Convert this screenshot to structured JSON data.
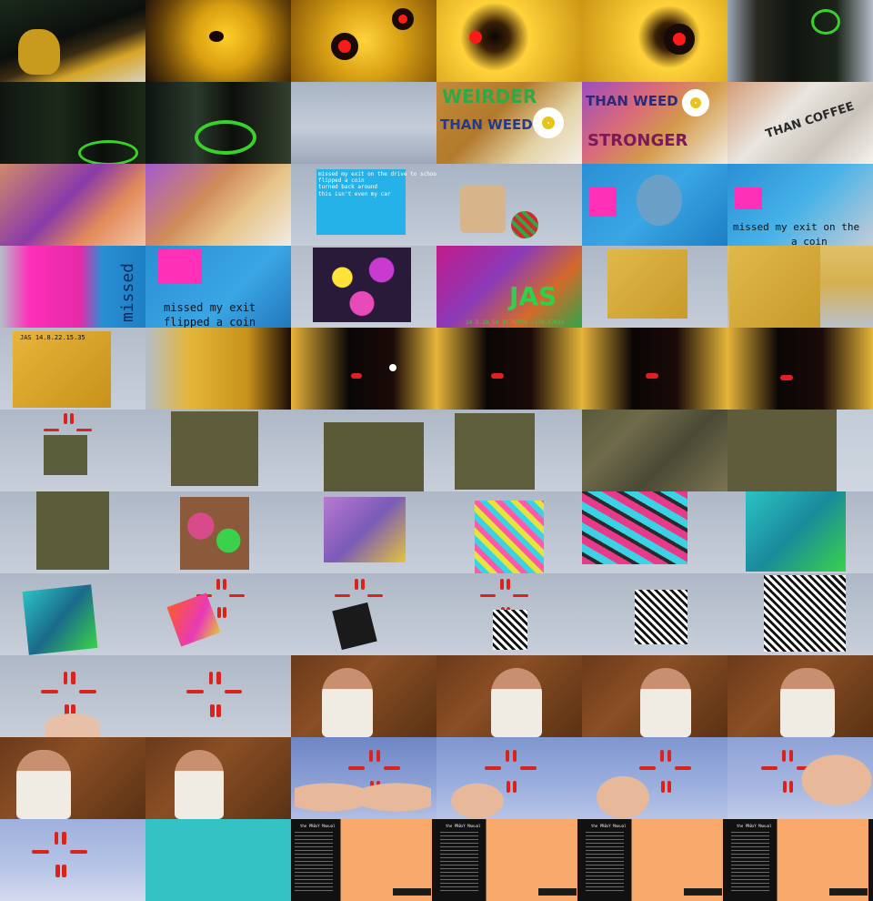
{
  "contact_sheet": {
    "columns": 6,
    "rows": 11,
    "frames": [
      {
        "name": "frame-r1c1",
        "bg": "linear-gradient(160deg,#1a2a1c 0%,#0c0f0c 45%,#3b2c12 60%,#d6a526 75%,#d8d0bc 100%)"
      },
      {
        "name": "frame-r1c2",
        "bg": "radial-gradient(circle at 55% 45%,#ffcf2a 0%,#d89e10 35%,#6b4608 70%,#1b0c0a 100%)"
      },
      {
        "name": "frame-r1c3",
        "bg": "radial-gradient(circle at 50% 50%,#ffd43a 0%,#d8a014 45%,#8a5a08 100%)"
      },
      {
        "name": "frame-r1c4",
        "bg": "radial-gradient(circle at 40% 45%,#0e0604 0%,#3a2006 15%,#ffd23a 35%,#c99312 100%)"
      },
      {
        "name": "frame-r1c5",
        "bg": "radial-gradient(circle at 60% 45%,#0e0604 0%,#3a2006 14%,#ffd23a 32%,#c99312 100%)"
      },
      {
        "name": "frame-r1c6",
        "bg": "linear-gradient(90deg,#9aa6b6 0%,#2a2a22 20%,#0f1410 45%,#1b241a 75%,#b6bcc8 100%)"
      },
      {
        "name": "frame-r2c1",
        "bg": "linear-gradient(90deg,#121612 0%,#1b2a1a 40%,#0c100c 70%,#1d2a18 100%)"
      },
      {
        "name": "frame-r2c2",
        "bg": "linear-gradient(90deg,#0e1410 0%,#2b3a2c 35%,#0c0f0c 60%,#34402e 100%)"
      },
      {
        "name": "frame-r2c3",
        "bg": "linear-gradient(180deg,#a8b4c4 0%,#c4ccd8 55%,#9da9bb 100%)"
      },
      {
        "name": "frame-r2c4",
        "bg": "linear-gradient(135deg,#c48a3a 0%,#b27a2c 40%,#e3d2a6 70%,#f4f0e8 100%)"
      },
      {
        "name": "frame-r2c5",
        "bg": "linear-gradient(135deg,#9b4fbf 0%,#d96a7a 35%,#d49a4a 60%,#f1ece2 100%)"
      },
      {
        "name": "frame-r2c6",
        "bg": "linear-gradient(135deg,#d59c78 0%,#e9e6e0 40%,#c9c3ba 70%,#f5f2ec 100%)"
      },
      {
        "name": "frame-r3c1",
        "bg": "linear-gradient(135deg,#d08a6a 0%,#8a3aa8 45%,#e28a5a 70%,#f3c4a4 100%)"
      },
      {
        "name": "frame-r3c2",
        "bg": "linear-gradient(135deg,#a35ad0 0%,#d08a5a 40%,#e7c48a 65%,#f0ece4 100%)"
      },
      {
        "name": "frame-r3c3",
        "bg": "linear-gradient(180deg,#a8b4c4 0%,#c4ccd8 100%)"
      },
      {
        "name": "frame-r3c4",
        "bg": "linear-gradient(180deg,#a8b4c4 0%,#c4ccd8 100%)"
      },
      {
        "name": "frame-r3c5",
        "bg": "linear-gradient(135deg,#2a8fd4 0%,#3aa6e4 50%,#1d7ec4 100%)"
      },
      {
        "name": "frame-r3c6",
        "bg": "linear-gradient(135deg,#2a8fd4 0%,#46b2e8 50%,#c4ccd8 100%)"
      },
      {
        "name": "frame-r4c1",
        "bg": "linear-gradient(90deg,#b4bdca 0%,#ff2fb8 20%,#e52aa8 55%,#2a8fd4 70%,#1d7ec4 100%)"
      },
      {
        "name": "frame-r4c2",
        "bg": "linear-gradient(135deg,#2a8fd4 0%,#3aa6e4 60%,#2277bd 100%)"
      },
      {
        "name": "frame-r4c3",
        "bg": "linear-gradient(180deg,#b4bdca 0%,#c8cfda 100%)"
      },
      {
        "name": "frame-r4c4",
        "bg": "linear-gradient(135deg,#c31a8a 0%,#8a3ab8 40%,#d46a2a 70%,#2fa44a 100%)"
      },
      {
        "name": "frame-r4c5",
        "bg": "linear-gradient(180deg,#aeb8c6 0%,#c5ccd8 100%)"
      },
      {
        "name": "frame-r4c6",
        "bg": "linear-gradient(180deg,#e0c06a 0%,#d6b050 45%,#b9c1cc 100%)"
      },
      {
        "name": "frame-r5c1",
        "bg": "linear-gradient(180deg,#b4bdca 0%,#c8cfda 100%)"
      },
      {
        "name": "frame-r5c2",
        "bg": "linear-gradient(90deg,#b4bdca 0%,#e4b63a 30%,#c8921a 70%,#1a0c08 100%)"
      },
      {
        "name": "frame-r5c3",
        "bg": "linear-gradient(90deg,#e8b43a 0%,#0a0606 40%,#1a0a08 70%,#e4b63a 100%)"
      },
      {
        "name": "frame-r5c4",
        "bg": "linear-gradient(90deg,#e8b43a 0%,#0a0606 35%,#1a0a08 65%,#e4b63a 100%)"
      },
      {
        "name": "frame-r5c5",
        "bg": "linear-gradient(90deg,#e8b43a 0%,#0a0606 35%,#1a0a08 65%,#e4b63a 100%)"
      },
      {
        "name": "frame-r5c6",
        "bg": "linear-gradient(90deg,#e8b43a 0%,#0a0606 35%,#1a0a08 65%,#e4b63a 100%)"
      },
      {
        "name": "frame-r6c1",
        "bg": "linear-gradient(180deg,#aeb8c6 0%,#c8cfda 100%)"
      },
      {
        "name": "frame-r6c2",
        "bg": "linear-gradient(180deg,#aeb8c6 0%,#c8cfda 100%)"
      },
      {
        "name": "frame-r6c3",
        "bg": "linear-gradient(180deg,#aeb8c6 0%,#c8cfda 100%)"
      },
      {
        "name": "frame-r6c4",
        "bg": "linear-gradient(180deg,#aeb8c6 0%,#c8cfda 100%)"
      },
      {
        "name": "frame-r6c5",
        "bg": "linear-gradient(135deg,#5a5a3a 0%,#6e6a4a 30%,#4a4a34 60%,#7a7450 100%)"
      },
      {
        "name": "frame-r6c6",
        "bg": "linear-gradient(180deg,#c2ccd8 0%,#d0d6e0 100%)"
      },
      {
        "name": "frame-r7c1",
        "bg": "linear-gradient(180deg,#aeb8c6 0%,#c8cfda 100%)"
      },
      {
        "name": "frame-r7c2",
        "bg": "linear-gradient(180deg,#aeb8c6 0%,#c8cfda 100%)"
      },
      {
        "name": "frame-r7c3",
        "bg": "linear-gradient(180deg,#aeb8c6 0%,#c8cfda 100%)"
      },
      {
        "name": "frame-r7c4",
        "bg": "linear-gradient(180deg,#aeb8c6 0%,#c8cfda 100%)"
      },
      {
        "name": "frame-r7c5",
        "bg": "linear-gradient(180deg,#aeb8c6 0%,#c8cfda 100%)"
      },
      {
        "name": "frame-r7c6",
        "bg": "linear-gradient(180deg,#aeb8c6 0%,#c8cfda 100%)"
      },
      {
        "name": "frame-r8c1",
        "bg": "linear-gradient(180deg,#aeb8c6 0%,#c8cfda 100%)"
      },
      {
        "name": "frame-r8c2",
        "bg": "linear-gradient(180deg,#aeb8c6 0%,#c8cfda 100%)"
      },
      {
        "name": "frame-r8c3",
        "bg": "linear-gradient(180deg,#aeb8c6 0%,#c8cfda 100%)"
      },
      {
        "name": "frame-r8c4",
        "bg": "linear-gradient(180deg,#aeb8c6 0%,#c8cfda 100%)"
      },
      {
        "name": "frame-r8c5",
        "bg": "linear-gradient(180deg,#aeb8c6 0%,#c8cfda 100%)"
      },
      {
        "name": "frame-r8c6",
        "bg": "linear-gradient(180deg,#aeb8c6 0%,#c8cfda 100%)"
      },
      {
        "name": "frame-r9c1",
        "bg": "linear-gradient(180deg,#aeb8c6 0%,#c8cfda 100%)"
      },
      {
        "name": "frame-r9c2",
        "bg": "linear-gradient(180deg,#aeb8c6 0%,#c8cfda 100%)"
      },
      {
        "name": "frame-r9c3",
        "bg": "linear-gradient(135deg,#6a3a1a 0%,#8a4e24 40%,#5a3214 100%)"
      },
      {
        "name": "frame-r9c4",
        "bg": "linear-gradient(135deg,#6a3a1a 0%,#8a4e24 40%,#5a3214 100%)"
      },
      {
        "name": "frame-r9c5",
        "bg": "linear-gradient(135deg,#6a3a1a 0%,#8a4e24 40%,#5a3214 100%)"
      },
      {
        "name": "frame-r9c6",
        "bg": "linear-gradient(135deg,#6a3a1a 0%,#8a4e24 40%,#5a3214 100%)"
      },
      {
        "name": "frame-r10c1",
        "bg": "linear-gradient(135deg,#6a3a1a 0%,#8a4e24 40%,#5a3214 100%)"
      },
      {
        "name": "frame-r10c2",
        "bg": "linear-gradient(135deg,#6a3a1a 0%,#8a4e24 40%,#5a3214 100%)"
      },
      {
        "name": "frame-r10c3",
        "bg": "linear-gradient(180deg,#6f86c6 0%,#8ea2d6 60%,#b2bfe4 100%)"
      },
      {
        "name": "frame-r10c4",
        "bg": "linear-gradient(180deg,#7f96d0 0%,#9cb0de 60%,#b6c4e6 100%)"
      },
      {
        "name": "frame-r10c5",
        "bg": "linear-gradient(180deg,#7f96d0 0%,#9cb0de 60%,#b6c4e6 100%)"
      },
      {
        "name": "frame-r10c6",
        "bg": "linear-gradient(180deg,#8ea2d6 0%,#a6b6e0 60%,#c2cce8 100%)"
      },
      {
        "name": "frame-r11c1",
        "bg": "linear-gradient(180deg,#9eb0dc 0%,#b6c4e6 60%,#d6dcee 100%)"
      },
      {
        "name": "frame-r11c2",
        "bg": "#35c2c4"
      },
      {
        "name": "frame-r11c3",
        "bg": "linear-gradient(90deg,#111 0%,#111 34%,#f7a86a 34%,#f7a86a 97%,#111 97%)"
      },
      {
        "name": "frame-r11c4",
        "bg": "linear-gradient(90deg,#111 0%,#111 34%,#f7a86a 34%,#f7a86a 97%,#111 97%)"
      },
      {
        "name": "frame-r11c5",
        "bg": "linear-gradient(90deg,#111 0%,#111 34%,#f7a86a 34%,#f7a86a 97%,#111 97%)"
      },
      {
        "name": "frame-r11c6",
        "bg": "linear-gradient(90deg,#111 0%,#111 34%,#f7a86a 34%,#f7a86a 97%,#111 97%)"
      }
    ],
    "frame_texts": {
      "r2c4_weirder": "WEIRDER",
      "r2c4_than_weed": "THAN WEED",
      "r2c5_than_weed": "THAN WEED",
      "r2c5_stronger": "STRONGER",
      "r2c6_than_coffee": "THAN COFFEE",
      "r3c3_poem": "missed my exit on the drive to school\nflipped a coin\nturned back around\nthis isn't even my car",
      "r3c6_missed": "missed my exit on the",
      "r3c6_coin": "a coin",
      "r4c1_missed": "missed",
      "r4c2_line1": "missed my exit",
      "r4c2_line2": "flipped a coin",
      "r4c4_jas": "JAS",
      "r4c4_coords": "14.8.18.54 35.07956 -120.52638",
      "r5c1_stamp": "JAS 14.8.22.15.35",
      "r11_manual_title": "the PR0xY Manual"
    },
    "colors": {
      "marker_red": "#d8241c",
      "paper": "#c4ccd8",
      "mustard": "#e4b63a",
      "hot_pink": "#ff2fb8",
      "sky_blue": "#2a8fd4",
      "teal": "#35c2c4",
      "peach": "#f7a86a"
    }
  }
}
